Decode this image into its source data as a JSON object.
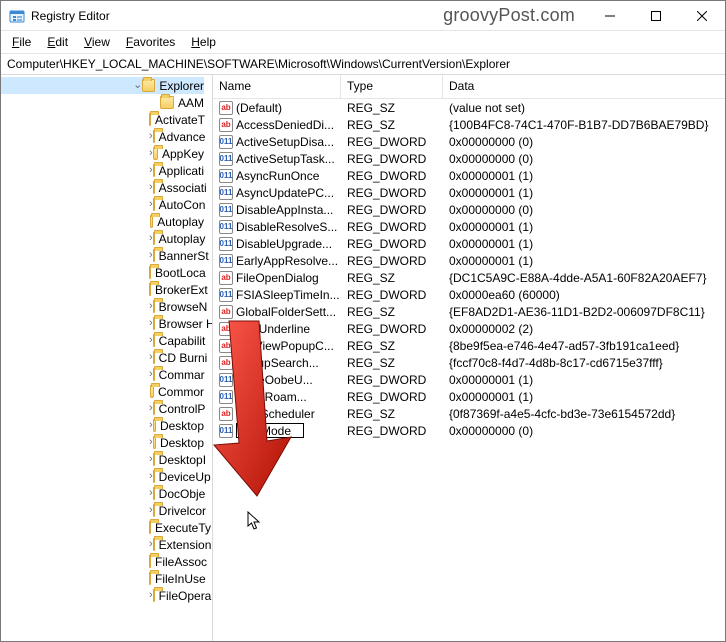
{
  "window": {
    "title": "Registry Editor",
    "watermark": "groovyPost.com"
  },
  "menu": {
    "file": "File",
    "edit": "Edit",
    "view": "View",
    "favorites": "Favorites",
    "help": "Help"
  },
  "address": "Computer\\HKEY_LOCAL_MACHINE\\SOFTWARE\\Microsoft\\Windows\\CurrentVersion\\Explorer",
  "columns": {
    "name": "Name",
    "type": "Type",
    "data": "Data"
  },
  "tree": {
    "current": "Explorer",
    "items": [
      {
        "label": "AAM",
        "exp": false
      },
      {
        "label": "ActivateT",
        "exp": false
      },
      {
        "label": "Advance",
        "exp": true
      },
      {
        "label": "AppKey",
        "exp": true
      },
      {
        "label": "Applicati",
        "exp": true
      },
      {
        "label": "Associati",
        "exp": true
      },
      {
        "label": "AutoCon",
        "exp": true
      },
      {
        "label": "Autoplay",
        "exp": false
      },
      {
        "label": "Autoplay",
        "exp": true
      },
      {
        "label": "BannerSt",
        "exp": true
      },
      {
        "label": "BootLoca",
        "exp": false
      },
      {
        "label": "BrokerExt",
        "exp": false
      },
      {
        "label": "BrowseN",
        "exp": true
      },
      {
        "label": "Browser H",
        "exp": true
      },
      {
        "label": "Capabilit",
        "exp": true
      },
      {
        "label": "CD Burni",
        "exp": true
      },
      {
        "label": "Commar",
        "exp": true
      },
      {
        "label": "Commor",
        "exp": false
      },
      {
        "label": "ControlP",
        "exp": true
      },
      {
        "label": "Desktop",
        "exp": true
      },
      {
        "label": "Desktop",
        "exp": true
      },
      {
        "label": "DesktopI",
        "exp": true
      },
      {
        "label": "DeviceUp",
        "exp": true
      },
      {
        "label": "DocObje",
        "exp": true
      },
      {
        "label": "Drivelcor",
        "exp": true
      },
      {
        "label": "ExecuteTy",
        "exp": false
      },
      {
        "label": "Extension",
        "exp": true
      },
      {
        "label": "FileAssoc",
        "exp": false
      },
      {
        "label": "FileInUse",
        "exp": false
      },
      {
        "label": "FileOpera",
        "exp": true
      }
    ]
  },
  "values": [
    {
      "icon": "str",
      "name": "(Default)",
      "type": "REG_SZ",
      "data": "(value not set)"
    },
    {
      "icon": "str",
      "name": "AccessDeniedDi...",
      "type": "REG_SZ",
      "data": "{100B4FC8-74C1-470F-B1B7-DD7B6BAE79BD}"
    },
    {
      "icon": "dword",
      "name": "ActiveSetupDisa...",
      "type": "REG_DWORD",
      "data": "0x00000000 (0)"
    },
    {
      "icon": "dword",
      "name": "ActiveSetupTask...",
      "type": "REG_DWORD",
      "data": "0x00000000 (0)"
    },
    {
      "icon": "dword",
      "name": "AsyncRunOnce",
      "type": "REG_DWORD",
      "data": "0x00000001 (1)"
    },
    {
      "icon": "dword",
      "name": "AsyncUpdatePC...",
      "type": "REG_DWORD",
      "data": "0x00000001 (1)"
    },
    {
      "icon": "dword",
      "name": "DisableAppInsta...",
      "type": "REG_DWORD",
      "data": "0x00000000 (0)"
    },
    {
      "icon": "dword",
      "name": "DisableResolveS...",
      "type": "REG_DWORD",
      "data": "0x00000001 (1)"
    },
    {
      "icon": "dword",
      "name": "DisableUpgrade...",
      "type": "REG_DWORD",
      "data": "0x00000001 (1)"
    },
    {
      "icon": "dword",
      "name": "EarlyAppResolve...",
      "type": "REG_DWORD",
      "data": "0x00000001 (1)"
    },
    {
      "icon": "str",
      "name": "FileOpenDialog",
      "type": "REG_SZ",
      "data": "{DC1C5A9C-E88A-4dde-A5A1-60F82A20AEF7}"
    },
    {
      "icon": "dword",
      "name": "FSIASleepTimeIn...",
      "type": "REG_DWORD",
      "data": "0x0000ea60 (60000)"
    },
    {
      "icon": "str",
      "name": "GlobalFolderSett...",
      "type": "REG_SZ",
      "data": "{EF8AD2D1-AE36-11D1-B2D2-006097DF8C11}"
    },
    {
      "icon": "str",
      "name": "IconUnderline",
      "type": "REG_DWORD",
      "data": "0x00000002 (2)"
    },
    {
      "icon": "str",
      "name": "ListViewPopupC...",
      "type": "REG_SZ",
      "data": "{8be9f5ea-e746-4e47-ad57-3fb191ca1eed}"
    },
    {
      "icon": "str",
      "name": "PopupSearch...",
      "type": "REG_SZ",
      "data": "{fccf70c8-f4d7-4d8b-8c17-cd6715e37fff}"
    },
    {
      "icon": "dword",
      "name": "chineOobeU...",
      "type": "REG_DWORD",
      "data": "0x00000001 (1)"
    },
    {
      "icon": "dword",
      "name": "aitOnRoam...",
      "type": "REG_DWORD",
      "data": "0x00000001 (1)"
    },
    {
      "icon": "str",
      "name": "TaskScheduler",
      "type": "REG_SZ",
      "data": "{0f87369f-a4e5-4cfc-bd3e-73e6154572dd}"
    },
    {
      "icon": "dword",
      "name": "",
      "type": "REG_DWORD",
      "data": "0x00000000 (0)",
      "editing": true,
      "edit_value": "HubMode"
    }
  ],
  "icon_glyphs": {
    "str": "ab",
    "dword": "011"
  }
}
